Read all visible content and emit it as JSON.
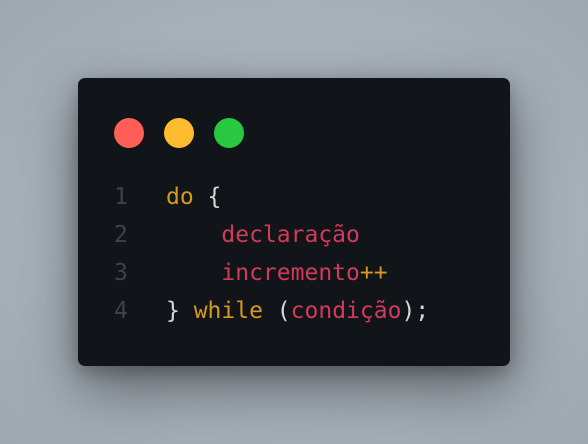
{
  "window": {
    "controls": [
      {
        "name": "close",
        "color": "#ff5f57"
      },
      {
        "name": "minimize",
        "color": "#febc2e"
      },
      {
        "name": "maximize",
        "color": "#28c840"
      }
    ]
  },
  "colors": {
    "keyword": "#d59a1c",
    "identifier": "#d23a5a",
    "punctuation": "#d6d8dc",
    "line_number": "#3e434b",
    "background": "#111419"
  },
  "code": {
    "lines": [
      {
        "number": "1",
        "keyword_do": "do",
        "open_brace": " {"
      },
      {
        "number": "2",
        "indent": "    ",
        "identifier": "declaração"
      },
      {
        "number": "3",
        "indent": "    ",
        "identifier": "incremento",
        "operator": "++"
      },
      {
        "number": "4",
        "close_brace": "} ",
        "keyword_while": "while",
        "open_paren": " (",
        "identifier": "condição",
        "close_paren": ");"
      }
    ]
  }
}
